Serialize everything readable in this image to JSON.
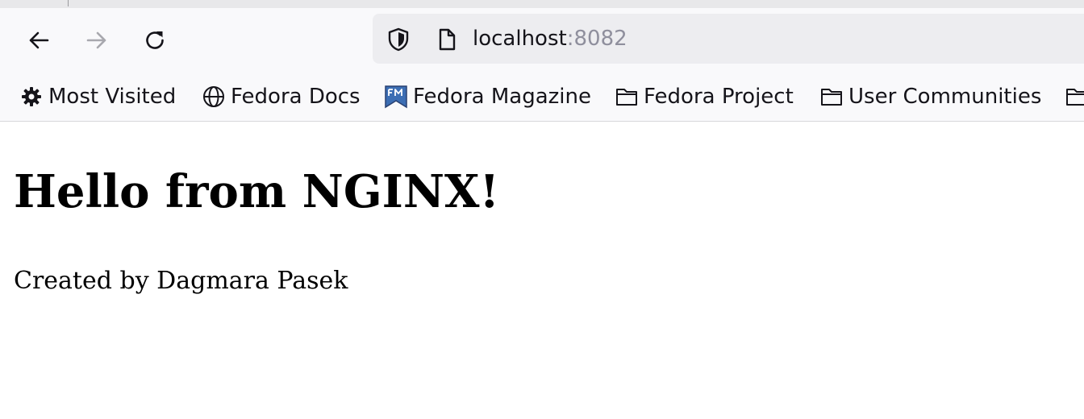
{
  "browser": {
    "url_host": "localhost",
    "url_port": ":8082",
    "icons": {
      "back": "arrow-left-icon",
      "forward": "arrow-right-icon",
      "reload": "reload-icon",
      "tracking": "shield-icon",
      "page": "page-icon"
    },
    "colors": {
      "toolbar_bg": "#f9f9fb",
      "urlbar_bg": "#ededf0",
      "port_text": "#8f8f9d"
    }
  },
  "bookmarks": [
    {
      "label": "Most Visited",
      "icon": "gear-icon"
    },
    {
      "label": "Fedora Docs",
      "icon": "globe-icon"
    },
    {
      "label": "Fedora Magazine",
      "icon": "fedora-magazine-icon"
    },
    {
      "label": "Fedora Project",
      "icon": "folder-icon"
    },
    {
      "label": "User Communities",
      "icon": "folder-icon"
    }
  ],
  "page": {
    "heading": "Hello from NGINX!",
    "byline": "Created by Dagmara Pasek"
  }
}
